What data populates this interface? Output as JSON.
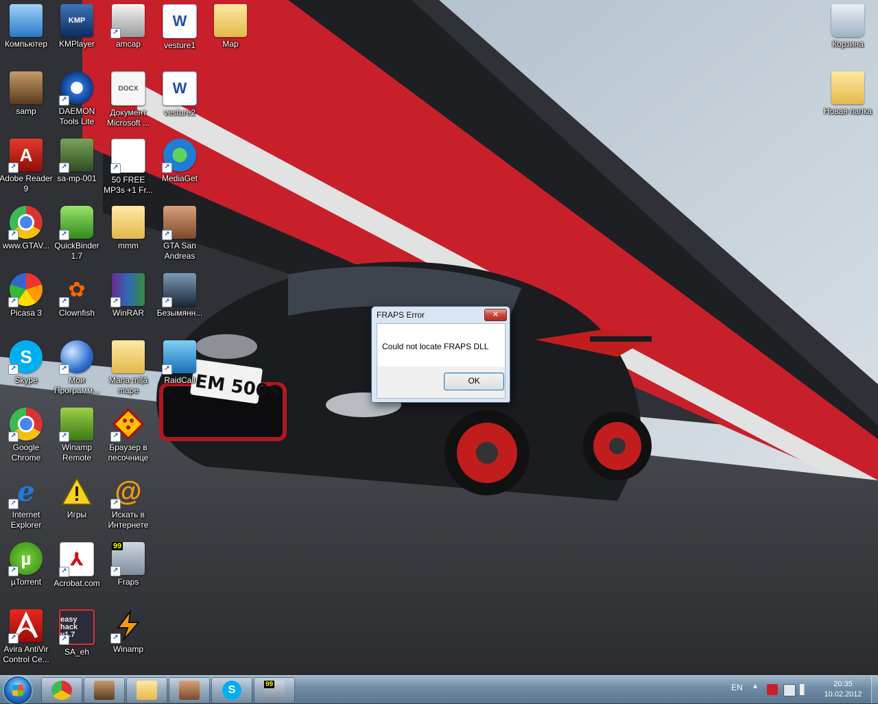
{
  "desktop_icons": [
    {
      "id": "computer",
      "label": "Компьютер",
      "glyph": "computer-icon"
    },
    {
      "id": "kmplayer",
      "label": "KMPlayer",
      "glyph": "kmp",
      "text": "KMP"
    },
    {
      "id": "amcap",
      "label": "amcap",
      "glyph": "amcap"
    },
    {
      "id": "vesture1",
      "label": "vesture1",
      "glyph": "word",
      "text": "W"
    },
    {
      "id": "map",
      "label": "Map",
      "glyph": "folder"
    },
    {
      "id": "samp",
      "label": "samp",
      "glyph": "samp"
    },
    {
      "id": "daemon",
      "label": "DAEMON Tools Lite",
      "glyph": "daemon"
    },
    {
      "id": "docx",
      "label": "Документ Microsoft ...",
      "glyph": "docx",
      "text": "DOCX"
    },
    {
      "id": "vesture2",
      "label": "vesture2",
      "glyph": "word",
      "text": "W"
    },
    {
      "id": "adobe",
      "label": "Adobe Reader 9",
      "glyph": "adobe",
      "text": "A"
    },
    {
      "id": "samp001",
      "label": "sa-mp-001",
      "glyph": "game"
    },
    {
      "id": "mp3",
      "label": "50 FREE MP3s +1 Fr...",
      "glyph": "list"
    },
    {
      "id": "mediaget",
      "label": "MediaGet",
      "glyph": "mediaget"
    },
    {
      "id": "gtav",
      "label": "www.GTAV...",
      "glyph": "chrome"
    },
    {
      "id": "quickbinder",
      "label": "QuickBinder 1.7",
      "glyph": "qb"
    },
    {
      "id": "mmm",
      "label": "mmm",
      "glyph": "folder"
    },
    {
      "id": "gtasa",
      "label": "GTA San Andreas",
      "glyph": "gta"
    },
    {
      "id": "picasa",
      "label": "Picasa 3",
      "glyph": "picasa"
    },
    {
      "id": "clownfish",
      "label": "Clownfish",
      "glyph": "fish",
      "text": "✿"
    },
    {
      "id": "winrar",
      "label": "WinRAR",
      "glyph": "winrar"
    },
    {
      "id": "untitled",
      "label": "Безымянн...",
      "glyph": "screen"
    },
    {
      "id": "skype",
      "label": "Skype",
      "glyph": "skype",
      "text": "S"
    },
    {
      "id": "myprograms",
      "label": "Мои Программ...",
      "glyph": "globe"
    },
    {
      "id": "manamape",
      "label": "Mana mīļā mape",
      "glyph": "folder"
    },
    {
      "id": "raidcall",
      "label": "RaidCall",
      "glyph": "raid"
    },
    {
      "id": "chrome",
      "label": "Google Chrome",
      "glyph": "chrome"
    },
    {
      "id": "winampremote",
      "label": "Winamp Remote",
      "glyph": "winampr"
    },
    {
      "id": "sandbox",
      "label": "Браузер в песочнице",
      "glyph": "browser"
    },
    {
      "id": "ie",
      "label": "Internet Explorer",
      "glyph": "ie",
      "text": "e"
    },
    {
      "id": "games",
      "label": "Игры",
      "glyph": "warn"
    },
    {
      "id": "websearch",
      "label": "Искать в Интернете",
      "glyph": "at",
      "text": "@"
    },
    {
      "id": "utorrent",
      "label": "µTorrent",
      "glyph": "utorrent",
      "text": "µ"
    },
    {
      "id": "acrobatcom",
      "label": "Acrobat.com",
      "glyph": "acro",
      "text": "⅄"
    },
    {
      "id": "fraps",
      "label": "Fraps",
      "glyph": "fraps",
      "text": "99"
    },
    {
      "id": "avira",
      "label": "Avira AntiVir Control Ce...",
      "glyph": "avira"
    },
    {
      "id": "saeh",
      "label": "SA_eh",
      "glyph": "easy",
      "text": "easy hack v1.7"
    },
    {
      "id": "winamp",
      "label": "Winamp",
      "glyph": "winamp"
    }
  ],
  "right_icons": [
    {
      "id": "recycle",
      "label": "Корзина",
      "glyph": "recycle"
    },
    {
      "id": "newfolder",
      "label": "Новая папка",
      "glyph": "folder"
    }
  ],
  "wallpaper": {
    "plate_text": "EM 5006"
  },
  "dialog": {
    "title": "FRAPS Error",
    "close": "✕",
    "message": "Could not locate FRAPS DLL",
    "ok": "OK"
  },
  "taskbar": {
    "buttons": [
      "chrome",
      "samp",
      "explorer",
      "gta",
      "skype",
      "fraps"
    ],
    "fraps_badge": "99",
    "language": "EN",
    "tray_arrow": "▲",
    "time": "20:35",
    "date": "10.02.2012"
  },
  "colors": {
    "accent_red": "#c8202a",
    "taskbar": "#6e8aa4",
    "dialog_frame": "#dbe6f3"
  }
}
